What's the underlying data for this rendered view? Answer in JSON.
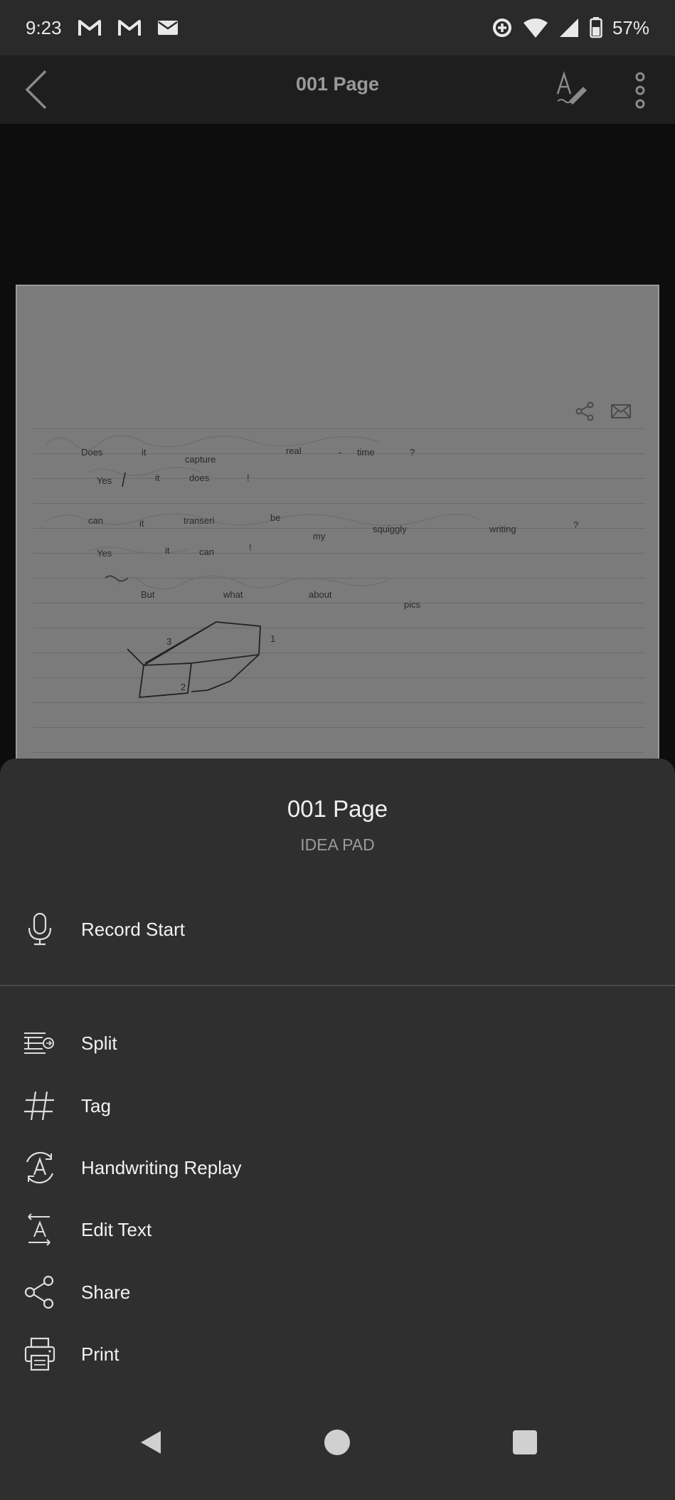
{
  "status": {
    "time": "9:23",
    "battery": "57%",
    "notifications": [
      "gmail-icon",
      "gmail-icon",
      "email-icon"
    ]
  },
  "appbar": {
    "title": "001 Page"
  },
  "note": {
    "words": [
      {
        "text": "Does"
      },
      {
        "text": "it"
      },
      {
        "text": "capture"
      },
      {
        "text": "real"
      },
      {
        "text": "-"
      },
      {
        "text": "time"
      },
      {
        "text": "?"
      },
      {
        "text": "Yes"
      },
      {
        "text": "it"
      },
      {
        "text": "does"
      },
      {
        "text": "!"
      },
      {
        "text": "can"
      },
      {
        "text": "it"
      },
      {
        "text": "transeri"
      },
      {
        "text": "be"
      },
      {
        "text": "my"
      },
      {
        "text": "squiggly"
      },
      {
        "text": "writing"
      },
      {
        "text": "?"
      },
      {
        "text": "Yes"
      },
      {
        "text": "it"
      },
      {
        "text": "can"
      },
      {
        "text": "!"
      },
      {
        "text": "But"
      },
      {
        "text": "what"
      },
      {
        "text": "about"
      },
      {
        "text": "pics"
      },
      {
        "text": "3"
      },
      {
        "text": "1"
      },
      {
        "text": "2"
      }
    ]
  },
  "sheet": {
    "title": "001 Page",
    "subtitle": "IDEA PAD",
    "record_label": "Record Start",
    "items": [
      {
        "label": "Split",
        "icon": "split-icon"
      },
      {
        "label": "Tag",
        "icon": "hash-icon"
      },
      {
        "label": "Handwriting Replay",
        "icon": "replay-icon"
      },
      {
        "label": "Edit Text",
        "icon": "edit-text-icon"
      },
      {
        "label": "Share",
        "icon": "share-icon"
      },
      {
        "label": "Print",
        "icon": "print-icon"
      }
    ]
  }
}
